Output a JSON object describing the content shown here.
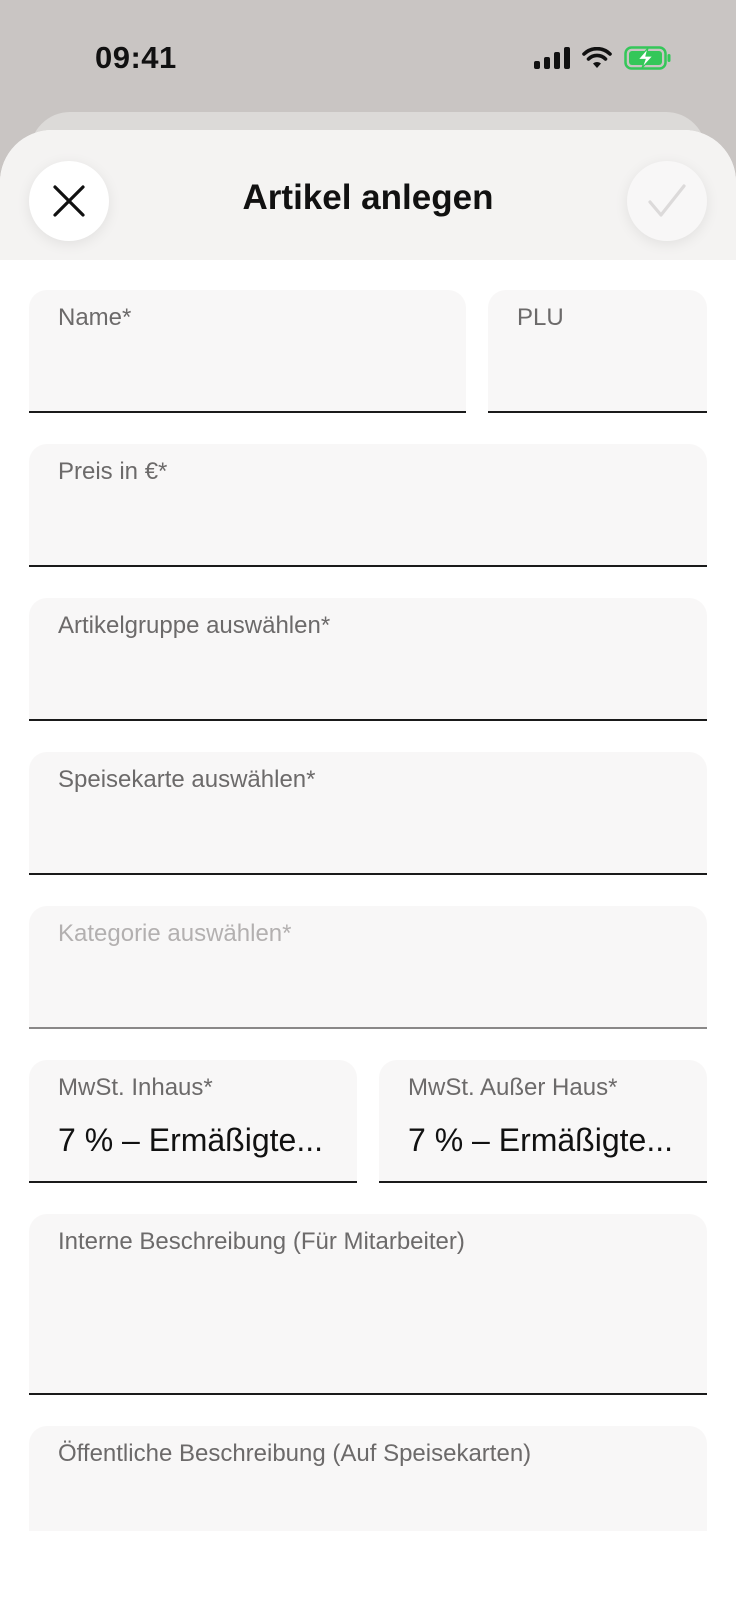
{
  "status_bar": {
    "time": "09:41",
    "icons": [
      "signal-icon",
      "wifi-icon",
      "battery-charging-icon"
    ],
    "battery_color": "#34c759"
  },
  "header": {
    "title": "Artikel anlegen",
    "close_icon": "close-icon",
    "confirm_icon": "checkmark-icon"
  },
  "form": {
    "name": {
      "label": "Name*",
      "value": ""
    },
    "plu": {
      "label": "PLU",
      "value": ""
    },
    "price": {
      "label": "Preis in €*",
      "value": ""
    },
    "article_group": {
      "label": "Artikelgruppe auswählen*",
      "value": ""
    },
    "menu": {
      "label": "Speisekarte auswählen*",
      "value": ""
    },
    "category": {
      "label": "Kategorie auswählen*",
      "value": "",
      "disabled": true
    },
    "vat_inhouse": {
      "label": "MwSt. Inhaus*",
      "value": "7 % – Ermäßigte..."
    },
    "vat_takeaway": {
      "label": "MwSt. Außer Haus*",
      "value": "7 % – Ermäßigte..."
    },
    "internal_description": {
      "label": "Interne Beschreibung (Für Mitarbeiter)",
      "value": ""
    },
    "public_description": {
      "label": "Öffentliche Beschreibung (Auf Speisekarten)",
      "value": ""
    }
  }
}
